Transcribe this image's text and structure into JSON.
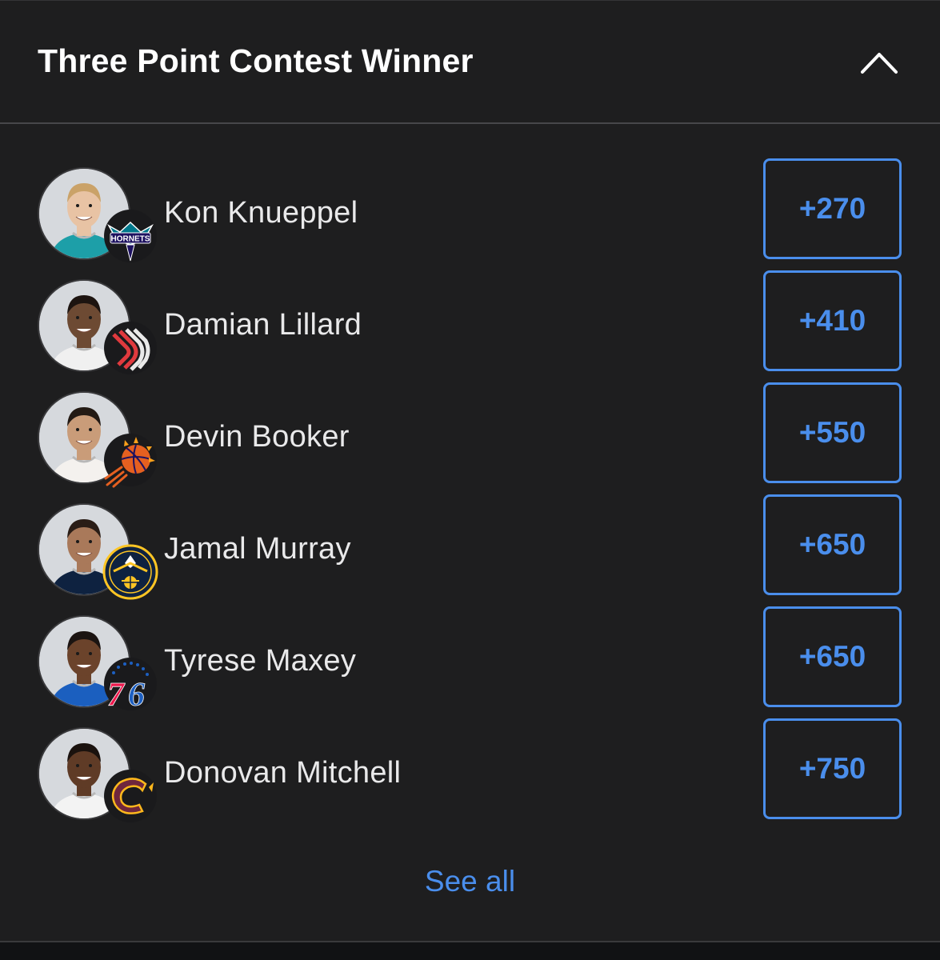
{
  "market": {
    "title": "Three Point Contest Winner",
    "collapse_icon": "chevron-up-icon"
  },
  "players": [
    {
      "name": "Kon Knueppel",
      "odds": "+270",
      "team": "Charlotte Hornets",
      "team_logo_text": "HORNETS",
      "jersey_color": "#1d9fa8",
      "skin": "#e8c3a4",
      "hair": "#caa268"
    },
    {
      "name": "Damian Lillard",
      "odds": "+410",
      "team": "Portland Trail Blazers",
      "jersey_color": "#f0f0f0",
      "skin": "#6d4a33",
      "hair": "#1d1410"
    },
    {
      "name": "Devin Booker",
      "odds": "+550",
      "team": "Phoenix Suns",
      "jersey_color": "#f4f1ee",
      "skin": "#c99c79",
      "hair": "#231a14"
    },
    {
      "name": "Jamal Murray",
      "odds": "+650",
      "team": "Denver Nuggets",
      "jersey_color": "#0e2240",
      "skin": "#a9795a",
      "hair": "#2a1d16"
    },
    {
      "name": "Tyrese Maxey",
      "odds": "+650",
      "team": "Philadelphia 76ers",
      "team_logo_text": "76",
      "jersey_color": "#1b5fbf",
      "skin": "#6b432b",
      "hair": "#1b1411"
    },
    {
      "name": "Donovan Mitchell",
      "odds": "+750",
      "team": "Cleveland Cavaliers",
      "jersey_color": "#f3f3f3",
      "skin": "#5f3b26",
      "hair": "#1a120e"
    }
  ],
  "see_all_label": "See all",
  "colors": {
    "accent": "#4a8eec",
    "panel_bg": "#1e1e1f",
    "text_primary": "#ffffff",
    "text_secondary": "#e9e9ea"
  }
}
